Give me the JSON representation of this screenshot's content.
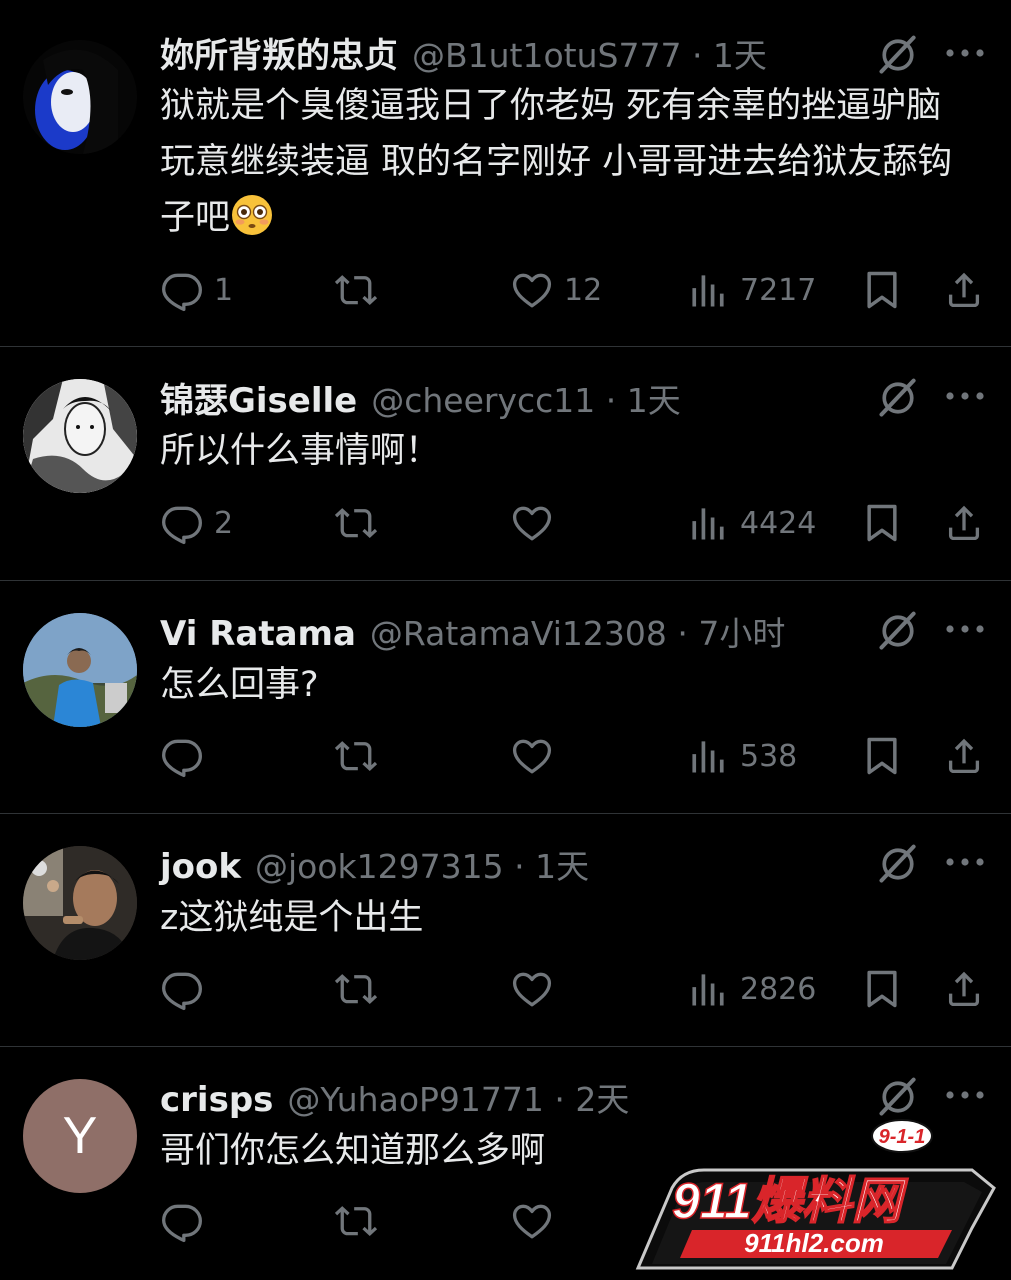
{
  "replies": [
    {
      "name": "妳所背叛的忠贞",
      "handle": "@B1ut1otuS777 · 1天",
      "text": "狱就是个臭傻逼我日了你老妈 死有余辜的挫逼驴脑玩意继续装逼 取的名字刚好 小哥哥进去给狱友舔钩子吧",
      "emoji": "flushed-face",
      "replies_count": "1",
      "retweets_count": "",
      "likes_count": "12",
      "views_count": "7217"
    },
    {
      "name": "锦瑟Giselle",
      "handle": "@cheerycc11 · 1天",
      "text": "所以什么事情啊！",
      "replies_count": "2",
      "retweets_count": "",
      "likes_count": "",
      "views_count": "4424"
    },
    {
      "name": "Vi Ratama",
      "handle": "@RatamaVi12308 · 7小时",
      "text": "怎么回事?",
      "replies_count": "",
      "retweets_count": "",
      "likes_count": "",
      "views_count": "538"
    },
    {
      "name": "jook",
      "handle": "@jook1297315 · 1天",
      "text": "z这狱纯是个出生",
      "replies_count": "",
      "retweets_count": "",
      "likes_count": "",
      "views_count": "2826"
    },
    {
      "name": "crisps",
      "handle": "@YuhaoP91771 · 2天",
      "text": "哥们你怎么知道那么多啊",
      "avatar_letter": "Y",
      "replies_count": "",
      "retweets_count": "",
      "likes_count": ""
    }
  ],
  "watermark": {
    "badge": "9-1-1",
    "brand": "911爆料网",
    "url": "911hl2.com"
  },
  "colors": {
    "background": "#000000",
    "primary_text": "#e7e9ea",
    "secondary_text": "#71767b",
    "divider": "#2f3336",
    "avatar_y": "#8f6f68",
    "watermark_red": "#d9252a"
  },
  "icons": [
    "reply-icon",
    "retweet-icon",
    "like-icon",
    "views-icon",
    "bookmark-icon",
    "share-icon",
    "grok-icon",
    "more-icon"
  ]
}
